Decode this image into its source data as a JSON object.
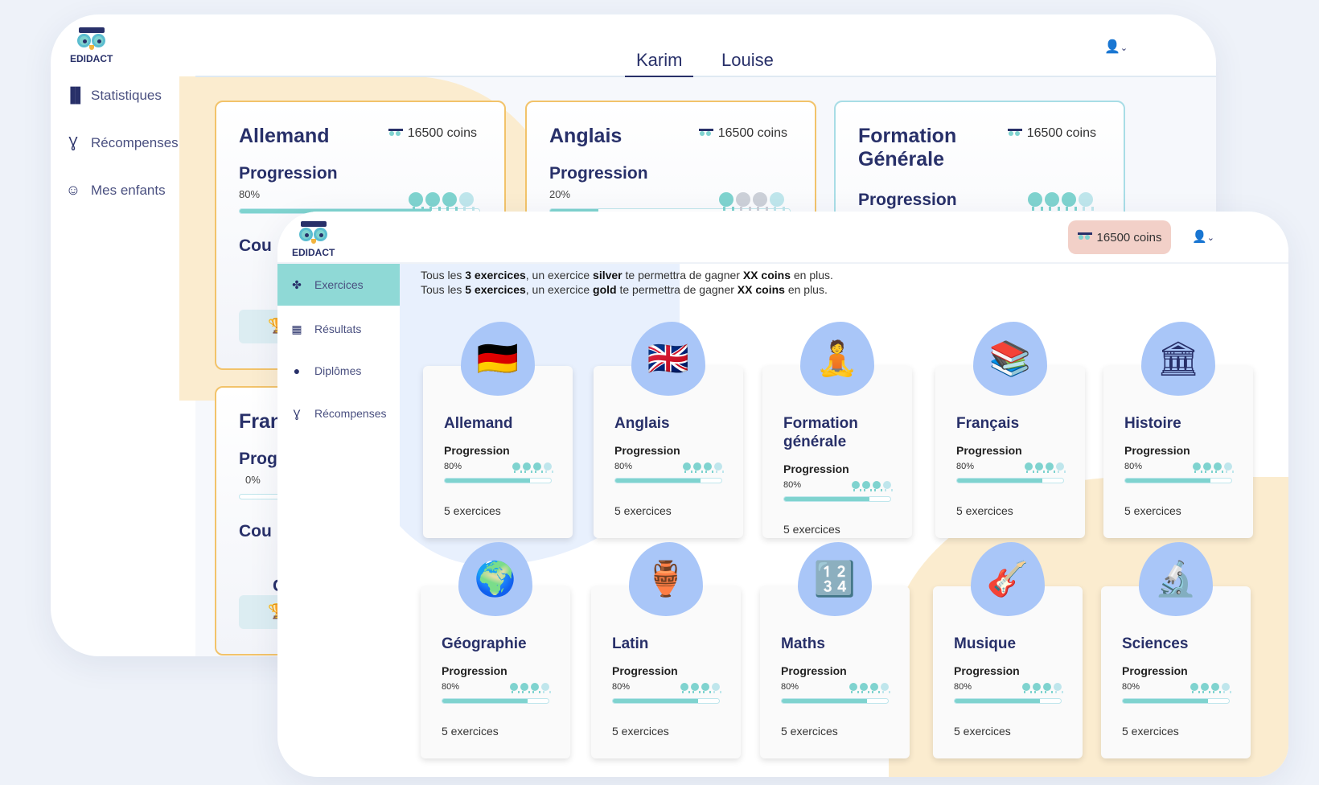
{
  "brand": "EDIDACT",
  "colors": {
    "navy": "#283069",
    "teal": "#7fd3cf",
    "peach": "#fbeccf",
    "coins_badge": "#f2d0c8"
  },
  "back": {
    "sidebar": [
      {
        "label": "Statistiques",
        "icon": "bar-chart-icon"
      },
      {
        "label": "Récompenses",
        "icon": "medal-icon"
      },
      {
        "label": "Mes enfants",
        "icon": "smiley-icon"
      }
    ],
    "tabs": [
      {
        "label": "Karim",
        "active": true
      },
      {
        "label": "Louise",
        "active": false
      }
    ],
    "cards": [
      {
        "title": "Allemand",
        "coins": "16500 coins",
        "progress_label": "Progression",
        "percent": "80%",
        "progress": 80,
        "medals": [
          "on",
          "on",
          "on",
          "off"
        ],
        "extra": "Cou"
      },
      {
        "title": "Anglais",
        "coins": "16500 coins",
        "progress_label": "Progression",
        "percent": "20%",
        "progress": 20,
        "medals": [
          "on",
          "grey",
          "grey",
          "off"
        ]
      },
      {
        "title": "Formation Générale",
        "coins": "16500 coins",
        "progress_label": "Progression",
        "medals": [
          "on",
          "on",
          "on",
          "off"
        ]
      },
      {
        "title": "Fran",
        "progress_label": "Prog",
        "percent": "0%",
        "progress": 0,
        "extra": "Cou",
        "extra2": "C"
      }
    ]
  },
  "front": {
    "coins": "16500 coins",
    "sidebar": [
      {
        "label": "Exercices",
        "icon": "exercises-icon",
        "active": true
      },
      {
        "label": "Résultats",
        "icon": "dashboard-icon"
      },
      {
        "label": "Diplômes",
        "icon": "diploma-icon"
      },
      {
        "label": "Récompenses",
        "icon": "medal-icon"
      }
    ],
    "info": [
      [
        "Tous les ",
        {
          "b": "3 exercices"
        },
        ", un exercice ",
        {
          "b": "silver"
        },
        " te permettra de gagner ",
        {
          "b": "XX coins"
        },
        " en plus."
      ],
      [
        "Tous les ",
        {
          "b": "5 exercices"
        },
        ", un exercice ",
        {
          "b": "gold"
        },
        " te permettra de gagner ",
        {
          "b": "XX coins"
        },
        " en plus."
      ]
    ],
    "subjects": [
      {
        "title": "Allemand",
        "icon": "🇩🇪"
      },
      {
        "title": "Anglais",
        "icon": "🇬🇧"
      },
      {
        "title": "Formation générale",
        "icon": "🧘"
      },
      {
        "title": "Français",
        "icon": "📚"
      },
      {
        "title": "Histoire",
        "icon": "🏛"
      },
      {
        "title": "Géographie",
        "icon": "🌍"
      },
      {
        "title": "Latin",
        "icon": "🏺"
      },
      {
        "title": "Maths",
        "icon": "🔢"
      },
      {
        "title": "Musique",
        "icon": "🎸"
      },
      {
        "title": "Sciences",
        "icon": "🔬"
      }
    ],
    "subject_common": {
      "progress_label": "Progression",
      "percent": "80%",
      "progress": 80,
      "count": "5 exercices",
      "medals": [
        "on",
        "on",
        "on",
        "off"
      ]
    }
  }
}
